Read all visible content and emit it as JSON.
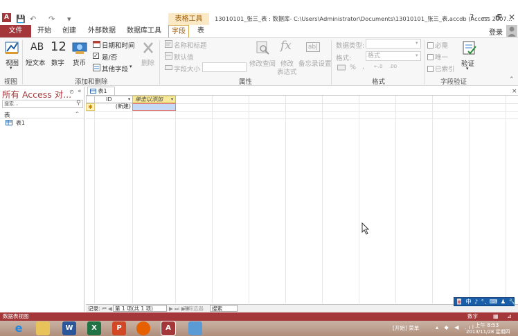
{
  "window": {
    "title": "13010101_张三_表 : 数据库- C:\\Users\\Administrator\\Documents\\13010101_张三_表.accdb (Access 2007...",
    "context_group": "表格工具",
    "help": "?",
    "minimize": "—",
    "restore": "🗗",
    "close": "✕",
    "login": "登录"
  },
  "qat": {
    "app_icon": "A",
    "save": "💾",
    "undo": "↶",
    "redo": "↷",
    "more": "▾"
  },
  "tabs": [
    "文件",
    "开始",
    "创建",
    "外部数据",
    "数据库工具",
    "字段",
    "表"
  ],
  "ribbon": {
    "view": {
      "label": "视图",
      "group": "视图"
    },
    "add_delete": {
      "short_text_icon": "AB",
      "short_text": "短文本",
      "number_icon": "12",
      "number": "数字",
      "currency": "货币",
      "datetime": "日期和时间",
      "yesno": "是/否",
      "more_fields": "其他字段",
      "delete": "删除",
      "group": "添加和删除"
    },
    "properties": {
      "name_caption": "名称和标题",
      "default_value": "默认值",
      "field_size": "字段大小",
      "modify_lookups": "修改查阅",
      "modify_expression_line1": "修改",
      "modify_expression_line2": "表达式",
      "memo_settings": "备忘录设置",
      "fx_icon": "fx",
      "abl_icon": "ab|",
      "group": "属性"
    },
    "formatting": {
      "data_type_label": "数据类型:",
      "format_label": "格式:",
      "format_value": "格式",
      "percent": "%",
      "comma": ",",
      "inc_decimal": "←.0",
      "dec_decimal": ".00",
      "group": "格式"
    },
    "validation": {
      "required": "必需",
      "unique": "唯一",
      "indexed": "已索引",
      "validate": "验证",
      "group": "字段验证"
    }
  },
  "nav": {
    "title": "所有 Access 对...",
    "search_placeholder": "搜索...",
    "group_label": "表",
    "items": [
      "表1"
    ]
  },
  "document": {
    "tab_label": "表1",
    "columns": [
      "ID",
      "单击以添加"
    ],
    "new_row_label": "(新建)",
    "new_row_marker": "✱"
  },
  "record_nav": {
    "label": "记录:",
    "position": "第 1 项(共 1 项)",
    "filter": "无筛选器",
    "search": "搜索"
  },
  "status": {
    "left": "数据表视图",
    "right": "数字"
  },
  "ime": "🀄 中 ♪ °, ⌨ ♟ 🔧",
  "taskbar": {
    "start_label": "[开始] 菜单",
    "time": "上午 8:53",
    "date": "2013/11/28 星期四"
  },
  "colors": {
    "accent": "#a4373a",
    "context": "#fbe9c6",
    "add_column": "#f7e99b",
    "selection": "#c6d9f7"
  }
}
